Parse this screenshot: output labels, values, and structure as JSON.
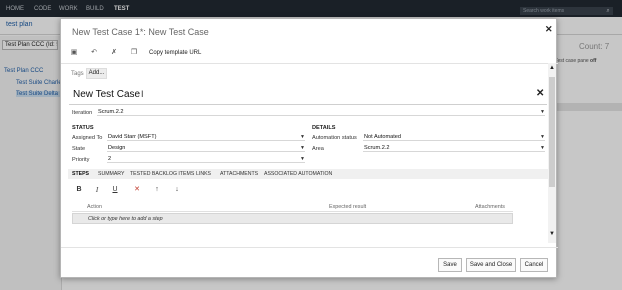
{
  "topnav": {
    "items": [
      "HOME",
      "CODE",
      "WORK",
      "BUILD",
      "TEST"
    ],
    "search_placeholder": "Search work items"
  },
  "subbar": {
    "title": "test plan"
  },
  "left_pane": {
    "plan_select": "Test Plan CCC (Id: 5",
    "tree": [
      "Test Plan CCC",
      "Test Suite Charle",
      "Test Suite Delta"
    ]
  },
  "right_bg": {
    "count": "Count: 7",
    "pane_label": "Test case pane",
    "pane_value": "off"
  },
  "dialog": {
    "title": "New Test Case 1*: New Test Case",
    "toolbar": {
      "copy_label": "Copy template URL"
    },
    "tags": {
      "label": "Tags",
      "add": "Add..."
    },
    "title_field": {
      "value": "New Test Case"
    },
    "iteration": {
      "label": "Iteration",
      "value": "Scrum.2.2"
    },
    "status": {
      "heading": "STATUS",
      "fields": [
        {
          "label": "Assigned To",
          "value": "David Starr (MSFT)"
        },
        {
          "label": "State",
          "value": "Design"
        },
        {
          "label": "Priority",
          "value": "2"
        }
      ]
    },
    "details": {
      "heading": "DETAILS",
      "fields": [
        {
          "label": "Automation status",
          "value": "Not Automated"
        },
        {
          "label": "Area",
          "value": "Scrum.2.2"
        }
      ]
    },
    "tabs": [
      "STEPS",
      "SUMMARY",
      "TESTED BACKLOG ITEMS",
      "LINKS",
      "ATTACHMENTS",
      "ASSOCIATED AUTOMATION"
    ],
    "steps": {
      "columns": {
        "action": "Action",
        "expected": "Expected result",
        "attachments": "Attachments"
      },
      "placeholder_row": "Click or type here to add a step"
    },
    "buttons": {
      "save": "Save",
      "save_close": "Save and Close",
      "cancel": "Cancel"
    }
  }
}
